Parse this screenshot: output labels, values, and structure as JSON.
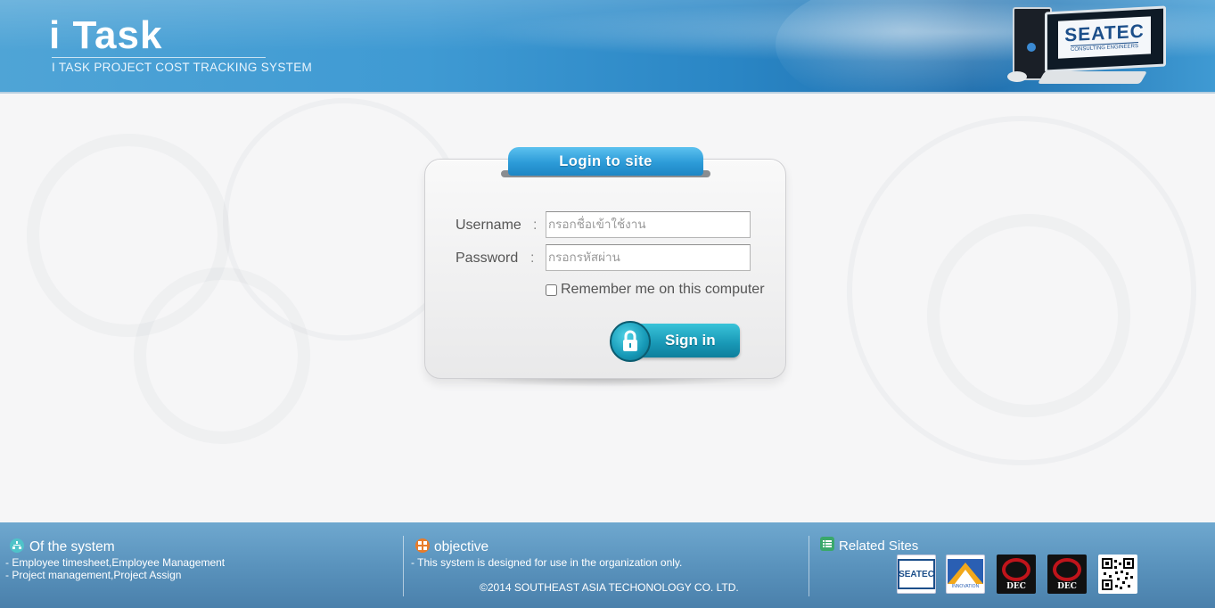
{
  "header": {
    "title": "i Task",
    "subtitle": "I TASK PROJECT COST TRACKING SYSTEM",
    "company_logo": "SEATEC",
    "company_logo_sub": "CONSULTING ENGINEERS"
  },
  "login": {
    "tab_title": "Login to site",
    "username_label": "Username",
    "password_label": "Password",
    "colon": ":",
    "username_placeholder": "กรอกชื่อเข้าใช้งาน",
    "password_placeholder": "กรอกรหัสผ่าน",
    "remember_label": "Remember me on this computer",
    "remember_checked": false,
    "signin_label": "Sign in",
    "signin_icon": "lock-icon"
  },
  "footer": {
    "system": {
      "heading": "Of the system",
      "icon": "sitemap-icon",
      "lines": [
        "- Employee timesheet,Employee Management",
        "- Project management,Project Assign"
      ]
    },
    "objective": {
      "heading": "objective",
      "icon": "grid-icon",
      "line": "- This system is designed for use in the organization only.",
      "copyright": "©2014 SOUTHEAST ASIA TECHONOLOGY CO. LTD."
    },
    "related": {
      "heading": "Related Sites",
      "icon": "list-icon",
      "sites": [
        {
          "name": "SEATEC",
          "color": "#1c4f8a"
        },
        {
          "name": "INNOVATION",
          "color": "#f2a81b"
        },
        {
          "name": "DEC",
          "color": "#c0141b"
        },
        {
          "name": "DEC",
          "color": "#c0141b"
        },
        {
          "name": "qr-code",
          "color": "#000000"
        }
      ]
    }
  },
  "colors": {
    "header_blue": "#3f9ad3",
    "tab_blue": "#2c9bd8",
    "signin_teal": "#1897b5",
    "footer_blue": "#5a93bd"
  }
}
